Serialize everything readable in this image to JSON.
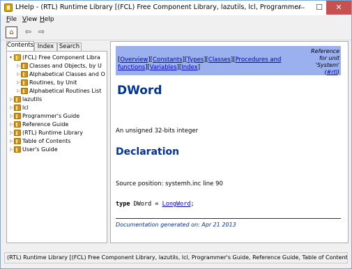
{
  "window": {
    "title": "LHelp - (RTL) Runtime Library [(FCL) Free Component Library, lazutils, lcl, Programmer's Guide, ..."
  },
  "window_controls": {
    "minimize": "—",
    "maximize": "☐",
    "close": "✕"
  },
  "menu": {
    "file": {
      "accel": "F",
      "rest": "ile"
    },
    "view": {
      "accel": "V",
      "rest": "iew"
    },
    "help": {
      "accel": "H",
      "rest": "elp"
    }
  },
  "toolbar": {
    "home_icon": "home-icon",
    "back_icon": "arrow-left-icon",
    "forward_icon": "arrow-right-icon",
    "back_glyph": "⇦",
    "forward_glyph": "⇨",
    "home_glyph": "⌂"
  },
  "tabs": [
    "Contents",
    "Index",
    "Search"
  ],
  "tree": [
    {
      "label": "(FCL) Free Component Libra",
      "level": 0,
      "expanded": true
    },
    {
      "label": "Classes and Objects, by U",
      "level": 1,
      "expanded": false
    },
    {
      "label": "Alphabetical Classes and O",
      "level": 1,
      "expanded": false
    },
    {
      "label": "Routines, by Unit",
      "level": 1,
      "expanded": false
    },
    {
      "label": "Alphabetical Routines List",
      "level": 1,
      "expanded": false
    },
    {
      "label": "lazutils",
      "level": 0,
      "expanded": false
    },
    {
      "label": "lcl",
      "level": 0,
      "expanded": false
    },
    {
      "label": "Programmer's Guide",
      "level": 0,
      "expanded": false
    },
    {
      "label": "Reference Guide",
      "level": 0,
      "expanded": false
    },
    {
      "label": "(RTL) Runtime Library",
      "level": 0,
      "expanded": false
    },
    {
      "label": "Table of Contents",
      "level": 0,
      "expanded": false
    },
    {
      "label": "User's Guide",
      "level": 0,
      "expanded": false
    }
  ],
  "content": {
    "nav": {
      "overview": "Overview",
      "constants": "Constants",
      "types": "Types",
      "classes": "Classes",
      "procedures": "Procedures and functions",
      "variables": "Variables",
      "index": "Index"
    },
    "ref": {
      "line1": "Reference",
      "line2": "for unit",
      "line3": "'System'",
      "link": "#rtl"
    },
    "heading": "DWord",
    "description": "An unsigned 32-bits integer",
    "declaration_heading": "Declaration",
    "source_position": "Source position: systemh.inc line 90",
    "code": {
      "keyword": "type",
      "name": "DWord",
      "eq": "=",
      "link": "LongWord",
      "end": ";"
    },
    "generated": "Documentation generated on: Apr 21 2013"
  },
  "status": "(RTL) Runtime Library [(FCL) Free Component Library, lazutils, lcl, Programmer's Guide, Reference Guide, Table of Contents, User's Guide]",
  "colors": {
    "navbar": "#9ab0ef",
    "heading": "#003399",
    "link": "#0000cc",
    "close": "#c75050"
  }
}
